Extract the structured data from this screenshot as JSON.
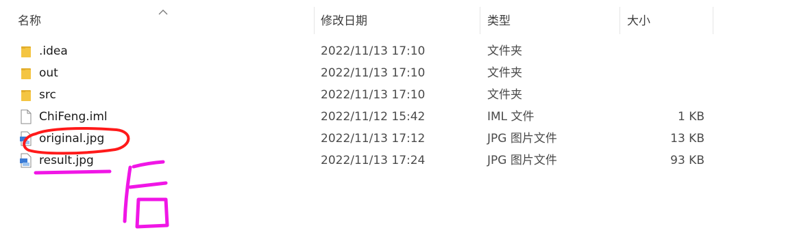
{
  "columns": {
    "name": "名称",
    "date": "修改日期",
    "type": "类型",
    "size": "大小"
  },
  "files": [
    {
      "icon": "folder-icon",
      "name": ".idea",
      "date": "2022/11/13 17:10",
      "type": "文件夹",
      "size": ""
    },
    {
      "icon": "folder-icon",
      "name": "out",
      "date": "2022/11/13 17:10",
      "type": "文件夹",
      "size": ""
    },
    {
      "icon": "folder-icon",
      "name": "src",
      "date": "2022/11/13 17:10",
      "type": "文件夹",
      "size": ""
    },
    {
      "icon": "file-icon",
      "name": "ChiFeng.iml",
      "date": "2022/11/12 15:42",
      "type": "IML 文件",
      "size": "1 KB"
    },
    {
      "icon": "jpg-image-icon",
      "name": "original.jpg",
      "date": "2022/11/13 17:12",
      "type": "JPG 图片文件",
      "size": "13 KB"
    },
    {
      "icon": "jpg-image-icon",
      "name": "result.jpg",
      "date": "2022/11/13 17:24",
      "type": "JPG 图片文件",
      "size": "93 KB"
    }
  ],
  "annotations": {
    "handwritten_text": "后",
    "colors": {
      "red_circle": "#ff1a1a",
      "magenta_ink": "#f016e6"
    }
  },
  "colors": {
    "folder": "#f4c542",
    "folder_dark": "#e2ad2a",
    "header_text": "#3c3c3c",
    "separator": "#e5e5e5"
  }
}
